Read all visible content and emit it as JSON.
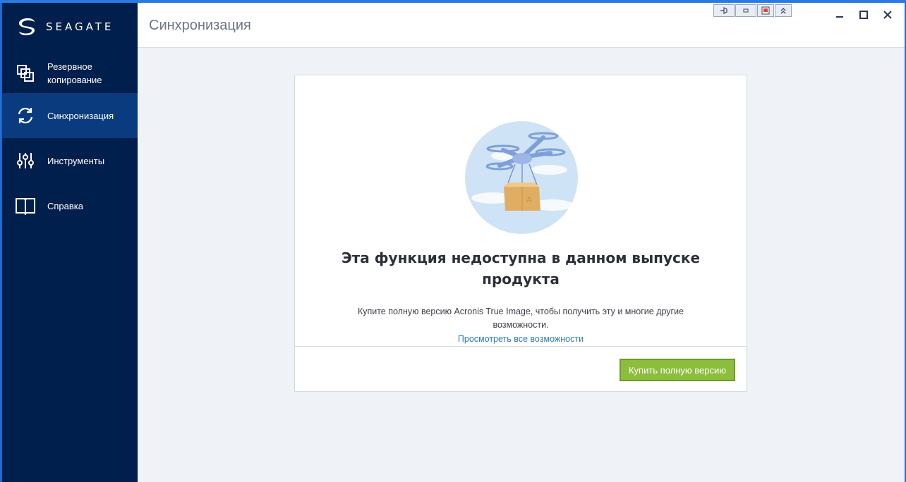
{
  "app": {
    "brand": "SEAGATE",
    "page_title": "Синхронизация"
  },
  "sidebar": {
    "items": [
      {
        "label": "Резервное копирование",
        "icon": "backup-copies-icon",
        "active": false
      },
      {
        "label": "Синхронизация",
        "icon": "sync-icon",
        "active": true
      },
      {
        "label": "Инструменты",
        "icon": "tools-sliders-icon",
        "active": false
      },
      {
        "label": "Справка",
        "icon": "book-icon",
        "active": false
      }
    ]
  },
  "window_controls": {
    "minimize": "minimize-icon",
    "maximize": "maximize-icon",
    "close": "close-icon"
  },
  "card": {
    "title": "Эта функция недоступна в данном выпуске продукта",
    "description": "Купите полную версию Acronis True Image, чтобы получить эту и многие другие возможности.",
    "link": "Просмотреть все возможности",
    "button": "Купить полную версию",
    "illustration": "drone-delivering-box-illustration"
  },
  "colors": {
    "sidebar_bg": "#001f4d",
    "sidebar_active": "#0a3b7e",
    "accent_button": "#8dbd3c",
    "link": "#2d7ab8"
  }
}
